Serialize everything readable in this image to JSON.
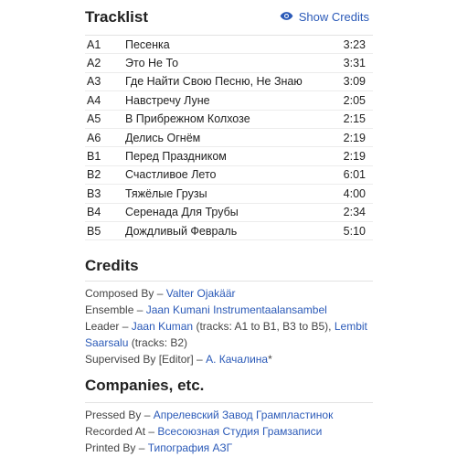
{
  "tracklist": {
    "heading": "Tracklist",
    "show_credits": "Show Credits",
    "tracks": [
      {
        "pos": "A1",
        "title": "Песенка",
        "dur": "3:23"
      },
      {
        "pos": "A2",
        "title": "Это Не То",
        "dur": "3:31"
      },
      {
        "pos": "A3",
        "title": "Где Найти Свою Песню, Не Знаю",
        "dur": "3:09"
      },
      {
        "pos": "A4",
        "title": "Навстречу Луне",
        "dur": "2:05"
      },
      {
        "pos": "A5",
        "title": "В Прибрежном Колхозе",
        "dur": "2:15"
      },
      {
        "pos": "A6",
        "title": "Делись Огнём",
        "dur": "2:19"
      },
      {
        "pos": "B1",
        "title": "Перед Праздником",
        "dur": "2:19"
      },
      {
        "pos": "B2",
        "title": "Счастливое Лето",
        "dur": "6:01"
      },
      {
        "pos": "B3",
        "title": "Тяжёлые Грузы",
        "dur": "4:00"
      },
      {
        "pos": "B4",
        "title": "Серенада Для Трубы",
        "dur": "2:34"
      },
      {
        "pos": "B5",
        "title": "Дождливый Февраль",
        "dur": "5:10"
      }
    ]
  },
  "credits": {
    "heading": "Credits",
    "composed_role": "Composed By – ",
    "composed_name": "Valter Ojakäär",
    "ensemble_role": "Ensemble – ",
    "ensemble_name": "Jaan Kumani Instrumentaalansambel",
    "leader_role": "Leader – ",
    "leader_name1": "Jaan Kuman",
    "leader_note1": " (tracks: A1 to B1, B3 to B5), ",
    "leader_name2a": "Lembit",
    "leader_name2b": "Saarsalu",
    "leader_note2": " (tracks: B2)",
    "supervised_role": "Supervised By [Editor] – ",
    "supervised_name": "А. Качалина",
    "supervised_suffix": "*"
  },
  "companies": {
    "heading": "Companies, etc.",
    "pressed_role": "Pressed By – ",
    "pressed_name": "Апрелевский Завод Грампластинок",
    "recorded_role": "Recorded At – ",
    "recorded_name": "Всесоюзная Студия Грамзаписи",
    "printed_role": "Printed By – ",
    "printed_name": "Типография АЗГ"
  }
}
